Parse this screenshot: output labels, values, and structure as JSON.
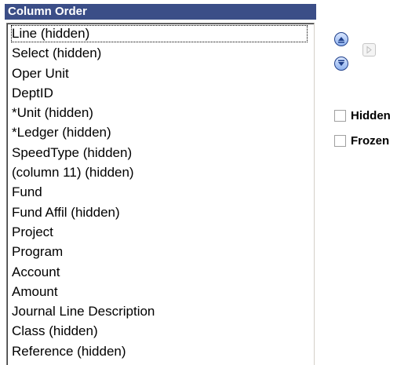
{
  "panel": {
    "title": "Column Order"
  },
  "columns": {
    "items": [
      {
        "label": "Line (hidden)",
        "focused": true
      },
      {
        "label": "Select (hidden)"
      },
      {
        "label": "Oper Unit"
      },
      {
        "label": "DeptID"
      },
      {
        "label": "*Unit (hidden)"
      },
      {
        "label": "*Ledger (hidden)"
      },
      {
        "label": "SpeedType (hidden)"
      },
      {
        "label": "(column 11) (hidden)"
      },
      {
        "label": "Fund"
      },
      {
        "label": "Fund Affil (hidden)"
      },
      {
        "label": "Project"
      },
      {
        "label": "Program"
      },
      {
        "label": "Account"
      },
      {
        "label": "Amount"
      },
      {
        "label": "Journal Line Description"
      },
      {
        "label": "Class (hidden)"
      },
      {
        "label": "Reference (hidden)"
      }
    ]
  },
  "controls": {
    "move_up_icon": "arrow-up-icon",
    "move_down_icon": "arrow-down-icon",
    "move_right_icon": "arrow-right-icon",
    "hidden_label": "Hidden",
    "frozen_label": "Frozen",
    "hidden_checked": false,
    "frozen_checked": false
  },
  "colors": {
    "header_bg": "#3b4e87",
    "header_text": "#ffffff",
    "button_blue": "#1f3f8a"
  }
}
